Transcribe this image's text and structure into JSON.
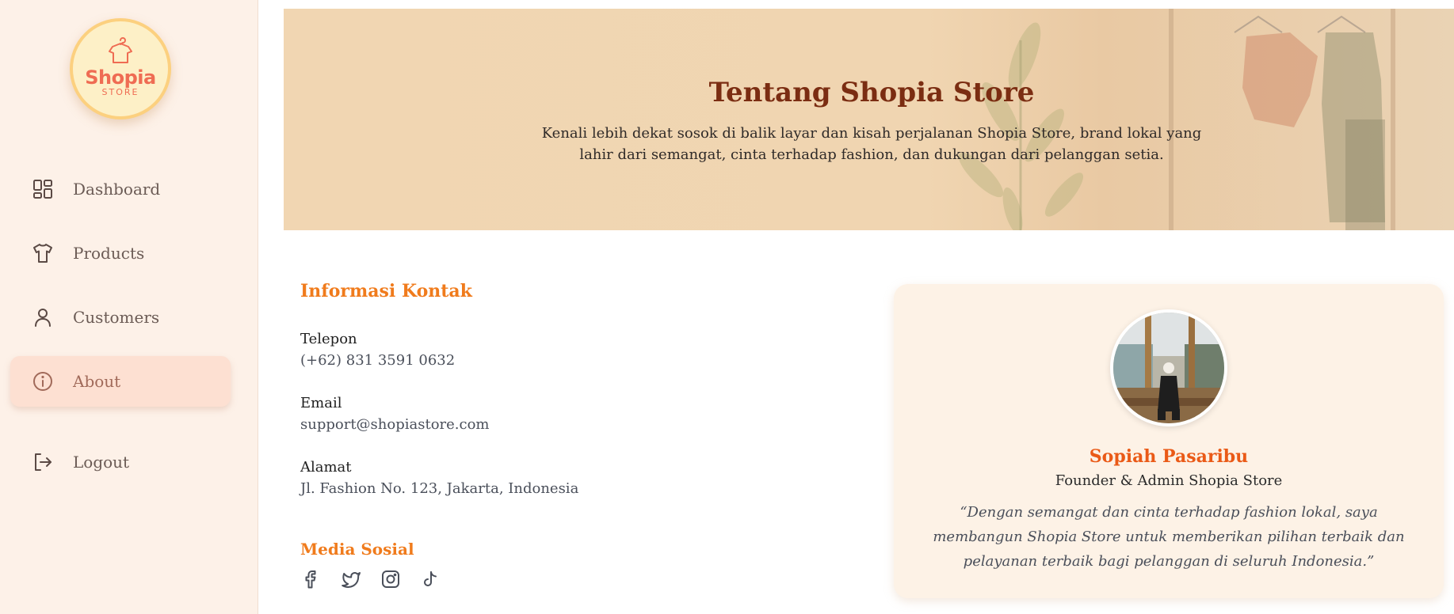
{
  "brand": {
    "name": "Shopia",
    "sub": "STORE"
  },
  "sidebar": {
    "items": [
      {
        "label": "Dashboard",
        "icon": "dashboard-grid-icon"
      },
      {
        "label": "Products",
        "icon": "tshirt-icon"
      },
      {
        "label": "Customers",
        "icon": "user-icon"
      },
      {
        "label": "About",
        "icon": "info-icon",
        "active": true
      },
      {
        "label": "Logout",
        "icon": "logout-icon"
      }
    ]
  },
  "hero": {
    "title": "Tentang Shopia Store",
    "subtitle": "Kenali lebih dekat sosok di balik layar dan kisah perjalanan Shopia Store, brand lokal yang lahir dari semangat, cinta terhadap fashion, dan dukungan dari pelanggan setia."
  },
  "contact": {
    "title": "Informasi Kontak",
    "phone_label": "Telepon",
    "phone_value": "(+62) 831 3591 0632",
    "email_label": "Email",
    "email_value": "support@shopiastore.com",
    "address_label": "Alamat",
    "address_value": "Jl. Fashion No. 123, Jakarta, Indonesia"
  },
  "social": {
    "title": "Media Sosial",
    "icons": [
      "facebook-icon",
      "twitter-icon",
      "instagram-icon",
      "tiktok-icon"
    ]
  },
  "founder": {
    "name": "Sopiah Pasaribu",
    "role": "Founder & Admin Shopia Store",
    "quote": "“Dengan semangat dan cinta terhadap fashion lokal, saya membangun Shopia Store untuk memberikan pilihan terbaik dan pelayanan terbaik bagi pelanggan di seluruh Indonesia.”"
  },
  "colors": {
    "accent": "#f07b1c",
    "hero_title": "#7b2d12",
    "sidebar_bg": "#fdf1e8",
    "active_bg": "#fde0d2",
    "card_bg": "#fdf2e6"
  }
}
